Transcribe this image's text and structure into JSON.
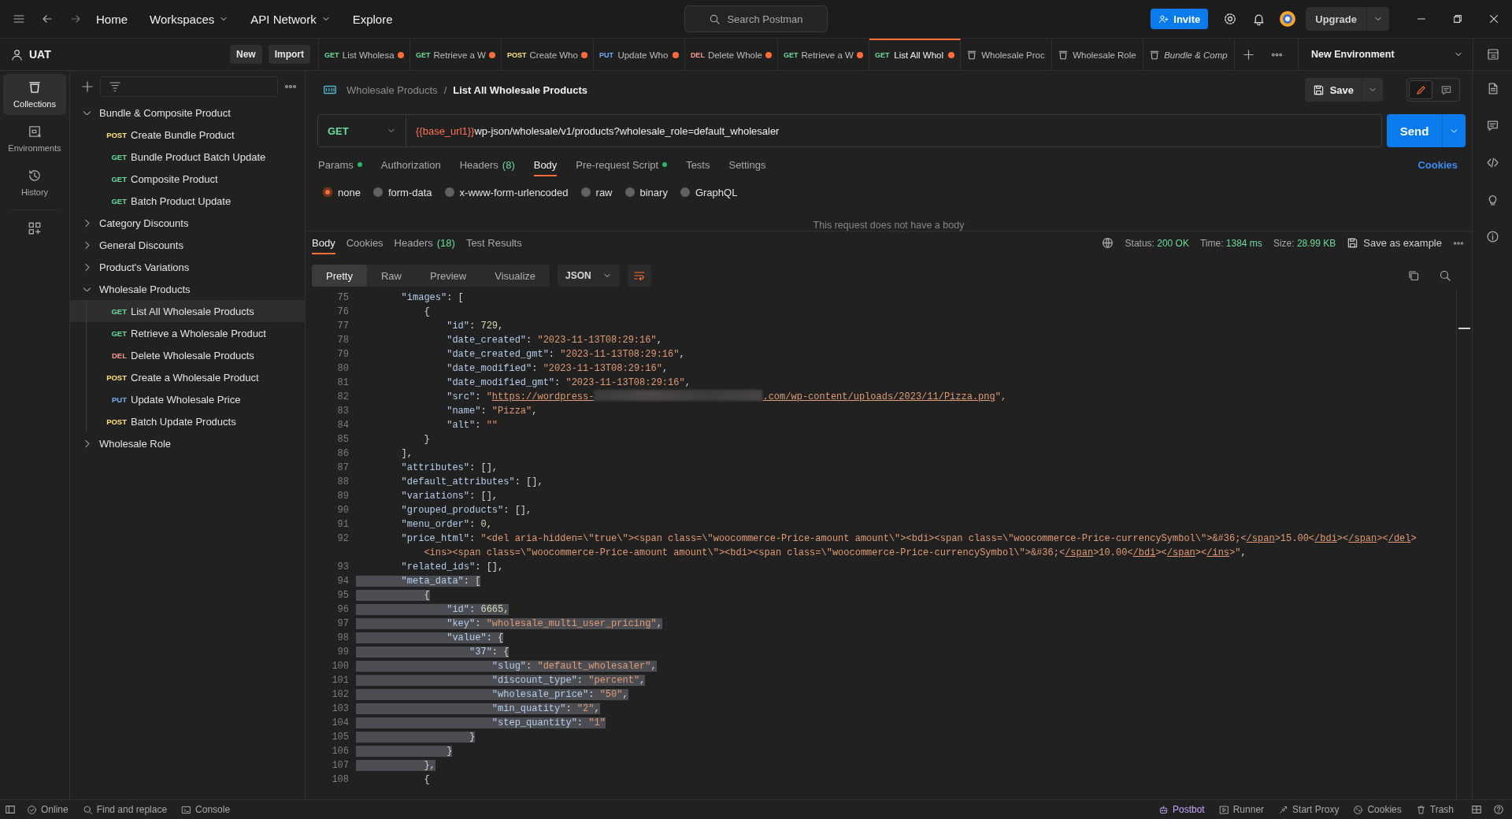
{
  "top_bar": {
    "nav": [
      {
        "label": "Home",
        "dropdown": false
      },
      {
        "label": "Workspaces",
        "dropdown": true
      },
      {
        "label": "API Network",
        "dropdown": true
      },
      {
        "label": "Explore",
        "dropdown": false
      }
    ],
    "search": {
      "placeholder": "Search Postman"
    },
    "invite": "Invite",
    "upgrade": "Upgrade"
  },
  "workspace": {
    "name": "UAT",
    "buttons": [
      "New",
      "Import"
    ]
  },
  "tabs": [
    {
      "kind": "request",
      "method": "GET",
      "color": "#6bdd9a",
      "label": "List Wholesa",
      "unsaved": true,
      "selected": false
    },
    {
      "kind": "request",
      "method": "GET",
      "color": "#6bdd9a",
      "label": "Retrieve a W",
      "unsaved": true,
      "selected": false
    },
    {
      "kind": "request",
      "method": "POST",
      "color": "#ffe47e",
      "label": "Create Who",
      "unsaved": true,
      "selected": false
    },
    {
      "kind": "request",
      "method": "PUT",
      "color": "#74aef6",
      "label": "Update Who",
      "unsaved": true,
      "selected": false
    },
    {
      "kind": "request",
      "method": "DEL",
      "color": "#f79a8e",
      "label": "Delete Whole",
      "unsaved": true,
      "selected": false
    },
    {
      "kind": "request",
      "method": "GET",
      "color": "#6bdd9a",
      "label": "Retrieve a W",
      "unsaved": true,
      "selected": false
    },
    {
      "kind": "request",
      "method": "GET",
      "color": "#6bdd9a",
      "label": "List All Whol",
      "unsaved": true,
      "selected": true
    },
    {
      "kind": "folder",
      "label": "Wholesale Proc",
      "preview": false,
      "selected": false
    },
    {
      "kind": "folder",
      "label": "Wholesale Role",
      "preview": false,
      "selected": false
    },
    {
      "kind": "folder",
      "label": "Bundle & Comp",
      "preview": true,
      "selected": false
    }
  ],
  "environment": "New Environment",
  "rail": [
    {
      "label": "Collections",
      "selected": true
    },
    {
      "label": "Environments",
      "selected": false
    },
    {
      "label": "History",
      "selected": false
    }
  ],
  "sidebar": {
    "items": [
      {
        "kind": "folder",
        "label": "Bundle & Composite Product",
        "expanded": true,
        "selected": false,
        "children": [
          {
            "kind": "request",
            "method": "POST",
            "color": "#ffe47e",
            "label": "Create Bundle Product",
            "selected": false
          },
          {
            "kind": "request",
            "method": "GET",
            "color": "#6bdd9a",
            "label": "Bundle Product Batch Update",
            "selected": false
          },
          {
            "kind": "request",
            "method": "GET",
            "color": "#6bdd9a",
            "label": "Composite Product",
            "selected": false
          },
          {
            "kind": "request",
            "method": "GET",
            "color": "#6bdd9a",
            "label": "Batch Product Update",
            "selected": false
          }
        ]
      },
      {
        "kind": "folder",
        "label": "Category Discounts",
        "expanded": false,
        "selected": false
      },
      {
        "kind": "folder",
        "label": "General Discounts",
        "expanded": false,
        "selected": false
      },
      {
        "kind": "folder",
        "label": "Product's Variations",
        "expanded": false,
        "selected": false
      },
      {
        "kind": "folder",
        "label": "Wholesale Products",
        "expanded": true,
        "selected": false,
        "children": [
          {
            "kind": "request",
            "method": "GET",
            "color": "#6bdd9a",
            "label": "List All Wholesale Products",
            "selected": true
          },
          {
            "kind": "request",
            "method": "GET",
            "color": "#6bdd9a",
            "label": "Retrieve a Wholesale Product",
            "selected": false
          },
          {
            "kind": "request",
            "method": "DEL",
            "color": "#f79a8e",
            "label": "Delete Wholesale Products",
            "selected": false
          },
          {
            "kind": "request",
            "method": "POST",
            "color": "#ffe47e",
            "label": "Create a Wholesale Product",
            "selected": false
          },
          {
            "kind": "request",
            "method": "PUT",
            "color": "#74aef6",
            "label": "Update Wholesale Price",
            "selected": false
          },
          {
            "kind": "request",
            "method": "POST",
            "color": "#ffe47e",
            "label": "Batch Update Products",
            "selected": false
          }
        ]
      },
      {
        "kind": "folder",
        "label": "Wholesale Role",
        "expanded": false,
        "selected": false
      }
    ]
  },
  "request": {
    "breadcrumb": {
      "parent": "Wholesale Products",
      "separator": "/",
      "current": "List All Wholesale Products"
    },
    "save": "Save",
    "method": "GET",
    "url": {
      "variable": "{{base_url1}}",
      "path": "wp-json/wholesale/v1/products?wholesale_role=default_wholesaler"
    },
    "send": "Send",
    "tabs": [
      {
        "label": "Params",
        "dot": true,
        "selected": false
      },
      {
        "label": "Authorization",
        "dot": false,
        "selected": false
      },
      {
        "label": "Headers",
        "count": "(8)",
        "dot": false,
        "selected": false
      },
      {
        "label": "Body",
        "dot": false,
        "selected": true
      },
      {
        "label": "Pre-request Script",
        "dot": true,
        "selected": false
      },
      {
        "label": "Tests",
        "dot": false,
        "selected": false
      },
      {
        "label": "Settings",
        "dot": false,
        "selected": false
      }
    ],
    "cookies": "Cookies",
    "body_types": [
      {
        "label": "none",
        "selected": true
      },
      {
        "label": "form-data",
        "selected": false
      },
      {
        "label": "x-www-form-urlencoded",
        "selected": false
      },
      {
        "label": "raw",
        "selected": false
      },
      {
        "label": "binary",
        "selected": false
      },
      {
        "label": "GraphQL",
        "selected": false
      }
    ],
    "empty_note": "This request does not have a body"
  },
  "response": {
    "tabs": [
      {
        "label": "Body",
        "selected": true
      },
      {
        "label": "Cookies",
        "selected": false
      },
      {
        "label": "Headers",
        "count": "(18)",
        "selected": false
      },
      {
        "label": "Test Results",
        "selected": false
      }
    ],
    "metrics": [
      {
        "label": "Status:",
        "value": "200 OK"
      },
      {
        "label": "Time:",
        "value": "1384 ms"
      },
      {
        "label": "Size:",
        "value": "28.99 KB"
      }
    ],
    "save_example": "Save as example",
    "views": [
      {
        "label": "Pretty",
        "selected": true
      },
      {
        "label": "Raw",
        "selected": false
      },
      {
        "label": "Preview",
        "selected": false
      },
      {
        "label": "Visualize",
        "selected": false
      }
    ],
    "format": "JSON",
    "lines": [
      {
        "number": "75",
        "text": "        \"images\": [",
        "selected": false
      },
      {
        "number": "76",
        "text": "            {",
        "selected": false
      },
      {
        "number": "77",
        "text": "                \"id\": 729,",
        "selected": false
      },
      {
        "number": "78",
        "text": "                \"date_created\": \"2023-11-13T08:29:16\",",
        "selected": false
      },
      {
        "number": "79",
        "text": "                \"date_created_gmt\": \"2023-11-13T08:29:16\",",
        "selected": false
      },
      {
        "number": "80",
        "text": "                \"date_modified\": \"2023-11-13T08:29:16\",",
        "selected": false
      },
      {
        "number": "81",
        "text": "                \"date_modified_gmt\": \"2023-11-13T08:29:16\",",
        "selected": false
      },
      {
        "number": "82",
        "selected": false,
        "parts": [
          {
            "kind": "code",
            "text": "                \"src\": \""
          },
          {
            "kind": "link",
            "text": "https://wordpress-"
          },
          {
            "kind": "redacted"
          },
          {
            "kind": "link",
            "text": ".com/wp-content/uploads/2023/11/Pizza.png"
          },
          {
            "kind": "code",
            "text": "\","
          }
        ]
      },
      {
        "number": "83",
        "text": "                \"name\": \"Pizza\",",
        "selected": false
      },
      {
        "number": "84",
        "text": "                \"alt\": \"\"",
        "selected": false
      },
      {
        "number": "85",
        "text": "            }",
        "selected": false
      },
      {
        "number": "86",
        "text": "        ],",
        "selected": false
      },
      {
        "number": "87",
        "text": "        \"attributes\": [],",
        "selected": false
      },
      {
        "number": "88",
        "text": "        \"default_attributes\": [],",
        "selected": false
      },
      {
        "number": "89",
        "text": "        \"variations\": [],",
        "selected": false
      },
      {
        "number": "90",
        "text": "        \"grouped_products\": [],",
        "selected": false
      },
      {
        "number": "91",
        "text": "        \"menu_order\": 0,",
        "selected": false
      },
      {
        "number": "92",
        "text": "        \"price_html\": \"<del aria-hidden=\\\"true\\\"><span class=\\\"woocommerce-Price-amount amount\\\"><bdi><span class=\\\"woocommerce-Price-currencySymbol\\\">&#36;</span>15.00</bdi></span></del>",
        "wrap": "            <ins><span class=\\\"woocommerce-Price-amount amount\\\"><bdi><span class=\\\"woocommerce-Price-currencySymbol\\\">&#36;</span>10.00</bdi></span></ins>\",",
        "selected": false
      },
      {
        "number": "93",
        "text": "        \"related_ids\": [],",
        "selected": false
      },
      {
        "number": "94",
        "text": "        \"meta_data\": [",
        "selected": true
      },
      {
        "number": "95",
        "text": "            {",
        "selected": true
      },
      {
        "number": "96",
        "text": "                \"id\": 6665,",
        "selected": true
      },
      {
        "number": "97",
        "text": "                \"key\": \"wholesale_multi_user_pricing\",",
        "selected": true
      },
      {
        "number": "98",
        "text": "                \"value\": {",
        "selected": true
      },
      {
        "number": "99",
        "text": "                    \"37\": {",
        "selected": true
      },
      {
        "number": "100",
        "text": "                        \"slug\": \"default_wholesaler\",",
        "selected": true
      },
      {
        "number": "101",
        "text": "                        \"discount_type\": \"percent\",",
        "selected": true
      },
      {
        "number": "102",
        "text": "                        \"wholesale_price\": \"50\",",
        "selected": true
      },
      {
        "number": "103",
        "text": "                        \"min_quatity\": \"2\",",
        "selected": true
      },
      {
        "number": "104",
        "text": "                        \"step_quantity\": \"1\"",
        "selected": true
      },
      {
        "number": "105",
        "text": "                    }",
        "selected": true
      },
      {
        "number": "106",
        "text": "                }",
        "selected": true
      },
      {
        "number": "107",
        "text": "            },",
        "selected": true
      },
      {
        "number": "108",
        "text": "            {",
        "selected": false
      }
    ]
  },
  "status_bar": {
    "left": [
      {
        "label": "Online"
      },
      {
        "label": "Find and replace"
      },
      {
        "label": "Console"
      }
    ],
    "right": [
      {
        "label": "Postbot"
      },
      {
        "label": "Runner"
      },
      {
        "label": "Start Proxy"
      },
      {
        "label": "Cookies"
      },
      {
        "label": "Trash"
      }
    ]
  }
}
